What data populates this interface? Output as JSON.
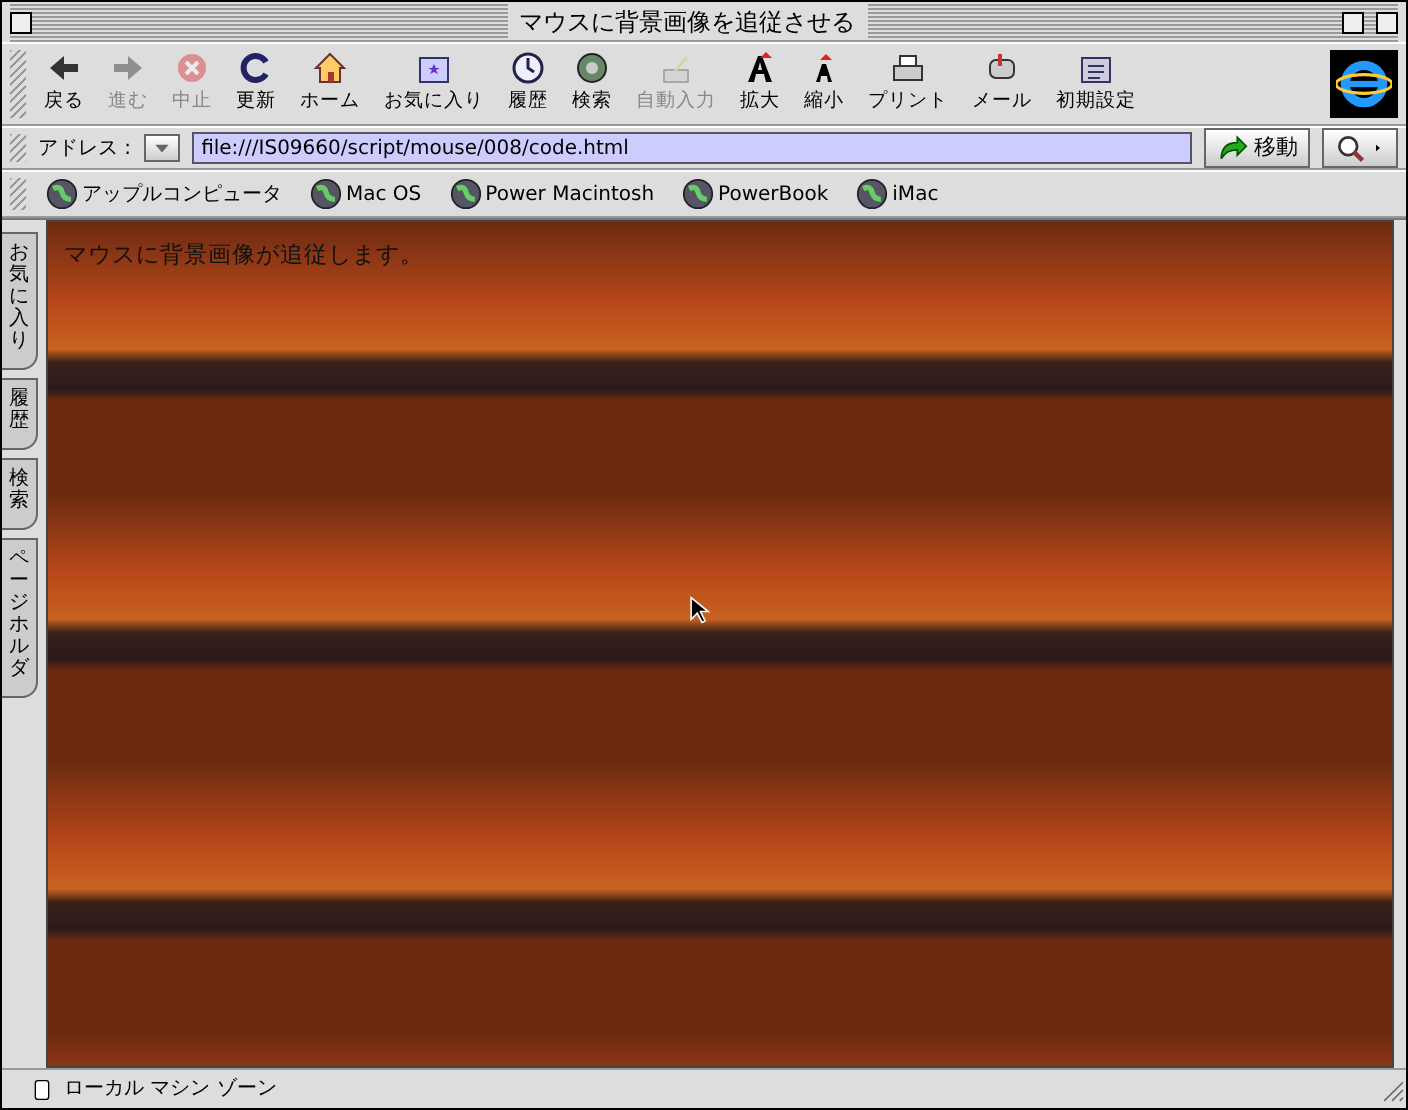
{
  "window": {
    "title": "マウスに背景画像を追従させる"
  },
  "toolbar": [
    {
      "label": "戻る",
      "kind": "back",
      "disabled": false
    },
    {
      "label": "進む",
      "kind": "forward",
      "disabled": true
    },
    {
      "label": "中止",
      "kind": "stop",
      "disabled": true
    },
    {
      "label": "更新",
      "kind": "refresh",
      "disabled": false
    },
    {
      "label": "ホーム",
      "kind": "home",
      "disabled": false
    },
    {
      "label": "お気に入り",
      "kind": "favorites",
      "disabled": false
    },
    {
      "label": "履歴",
      "kind": "history",
      "disabled": false
    },
    {
      "label": "検索",
      "kind": "search",
      "disabled": false
    },
    {
      "label": "自動入力",
      "kind": "autofill",
      "disabled": true
    },
    {
      "label": "拡大",
      "kind": "larger",
      "disabled": false
    },
    {
      "label": "縮小",
      "kind": "smaller",
      "disabled": false
    },
    {
      "label": "プリント",
      "kind": "print",
      "disabled": false
    },
    {
      "label": "メール",
      "kind": "mail",
      "disabled": false
    },
    {
      "label": "初期設定",
      "kind": "prefs",
      "disabled": false
    }
  ],
  "address_bar": {
    "label": "アドレス :",
    "value": "file:///IS09660/script/mouse/008/code.html",
    "go_button": "移動"
  },
  "favorites_bar": [
    {
      "label": "アップルコンピュータ"
    },
    {
      "label": "Mac OS"
    },
    {
      "label": "Power Macintosh"
    },
    {
      "label": "PowerBook"
    },
    {
      "label": "iMac"
    }
  ],
  "side_tabs": [
    {
      "label": "お気に入り"
    },
    {
      "label": "履歴"
    },
    {
      "label": "検索"
    },
    {
      "label": "ページホルダ"
    }
  ],
  "page": {
    "text": "マウスに背景画像が追従します。"
  },
  "status_bar": {
    "text": "ローカル マシン ゾーン"
  }
}
